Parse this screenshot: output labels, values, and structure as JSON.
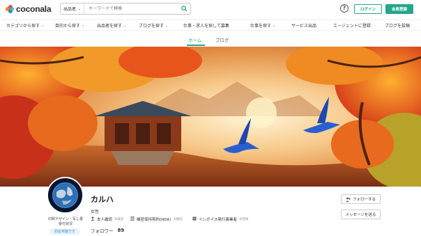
{
  "brand": {
    "name": "coconala"
  },
  "header": {
    "search_category": "出品者",
    "search_placeholder": "キーワードで検索",
    "login_label": "ログイン",
    "register_label": "会員登録",
    "help_label": "?"
  },
  "catnav": {
    "items": [
      {
        "label": "カテゴリから探す",
        "has_chevron": true
      },
      {
        "label": "目的から探す",
        "has_chevron": true
      },
      {
        "label": "出品者を探す",
        "has_chevron": true
      },
      {
        "label": "ブログを探す",
        "has_chevron": true
      },
      {
        "label": "仕事・求人を探して募集",
        "has_chevron": false
      },
      {
        "label": "仕事を探す",
        "has_chevron": true
      },
      {
        "label": "サービス出品",
        "has_chevron": false
      },
      {
        "label": "エージェントに登録",
        "has_chevron": false
      },
      {
        "label": "ブログを投稿",
        "has_chevron": false
      }
    ]
  },
  "tabs": [
    {
      "label": "ホーム",
      "active": true
    },
    {
      "label": "ブログ",
      "active": false
    }
  ],
  "profile": {
    "name": "カルハ",
    "gender": "女性",
    "avatar_caption": "印刷デザイン・写し書\n受付状況",
    "badge": "対応可能です",
    "verifications": [
      {
        "label": "本人確認",
        "status": "未確認",
        "icon": "person-icon"
      },
      {
        "label": "機密保持契約(NDA)",
        "status": "未確認",
        "icon": "document-icon"
      },
      {
        "label": "インボイス発行事業者",
        "status": "未登録",
        "icon": "invoice-icon"
      }
    ],
    "followers_label": "フォロワー",
    "followers_count": "89",
    "follow_button": "フォローする",
    "message_button": "メッセージを送る"
  },
  "colors": {
    "accent": "#25a58a",
    "badge_text": "#2a7fc0",
    "badge_bg": "#e8f3fb"
  }
}
